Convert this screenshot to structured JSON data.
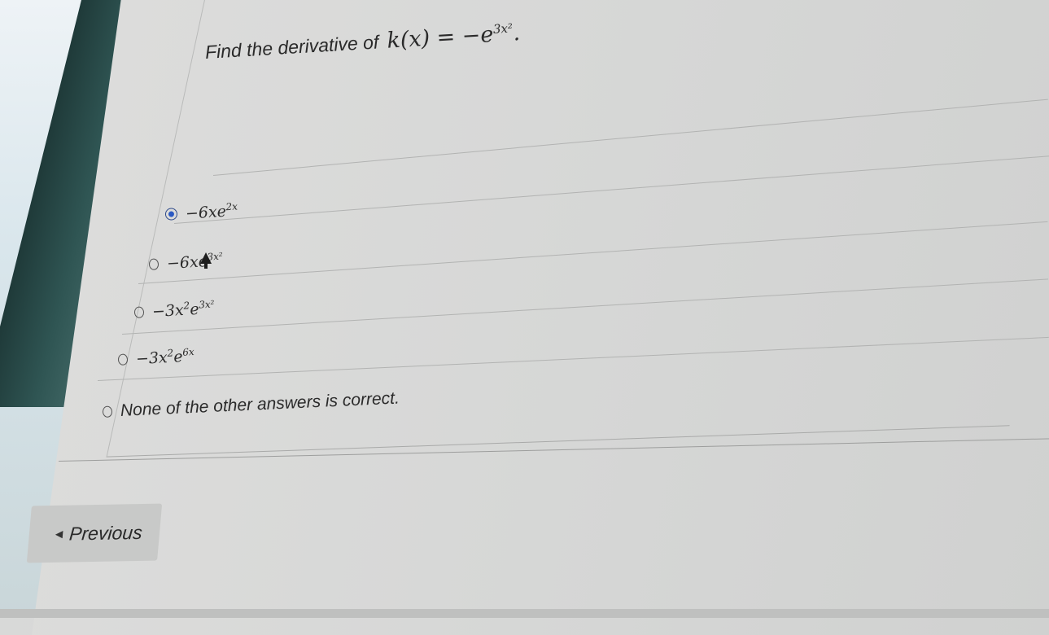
{
  "question": {
    "prefix": "Find the derivative of",
    "func": "k(x) = −e",
    "exponent": "3x²",
    "suffix": "."
  },
  "options": [
    {
      "base": "−6xe",
      "exp": "2x",
      "tail": "",
      "selected": true
    },
    {
      "base": "−6xe",
      "exp": "3x²",
      "tail": "",
      "selected": false
    },
    {
      "base": "−3x",
      "exp": "2",
      "tail": "e",
      "exp2": "3x²",
      "selected": false
    },
    {
      "base": "−3x",
      "exp": "2",
      "tail": "e",
      "exp2": "6x",
      "selected": false
    },
    {
      "text": "None of the other answers is correct.",
      "selected": false
    }
  ],
  "nav": {
    "previous_label": "Previous"
  },
  "colors": {
    "radio_selected": "#2b59c3",
    "background": "#d4d5d4"
  }
}
